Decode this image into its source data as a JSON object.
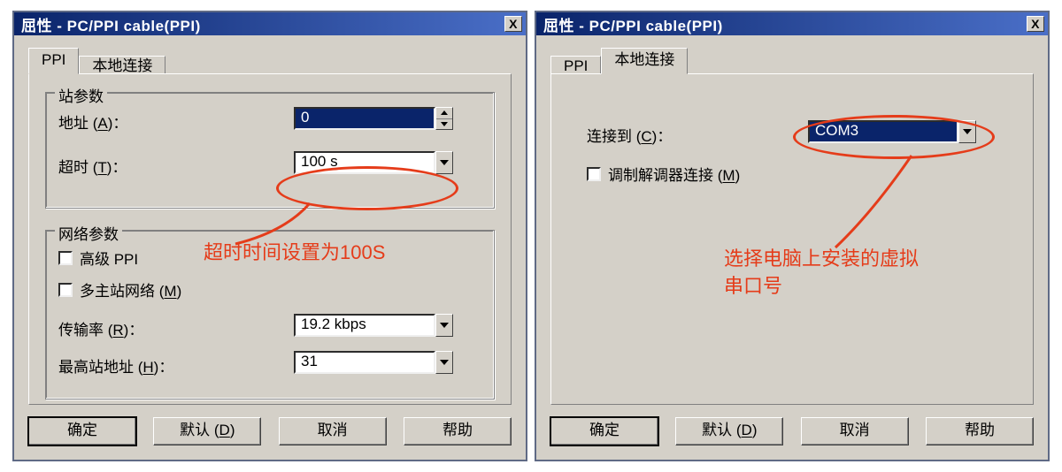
{
  "window": {
    "title": "屈性 - PC/PPI cable(PPI)",
    "close_symbol": "X"
  },
  "tabs": {
    "ppi": "PPI",
    "local": "本地连接"
  },
  "left": {
    "group_station": "站参数",
    "address_label": "地址 (A)：",
    "address_value": "0",
    "timeout_label": "超时 (T)：",
    "timeout_value": "100 s",
    "group_network": "网络参数",
    "advanced_ppi": "高级 PPI",
    "multi_master": "多主站网络 (M)",
    "baud_label": "传输率 (R)：",
    "baud_value": "19.2 kbps",
    "max_addr_label": "最高站地址 (H)：",
    "max_addr_value": "31"
  },
  "right": {
    "connect_label": "连接到 (C)：",
    "connect_value": "COM3",
    "modem_label": "调制解调器连接 (M)"
  },
  "buttons": {
    "ok": "确定",
    "default": "默认 (D)",
    "cancel": "取消",
    "help": "帮助"
  },
  "annotations": {
    "left_note": "超时时间设置为100S",
    "right_note": "选择电脑上安装的虚拟串口号"
  }
}
